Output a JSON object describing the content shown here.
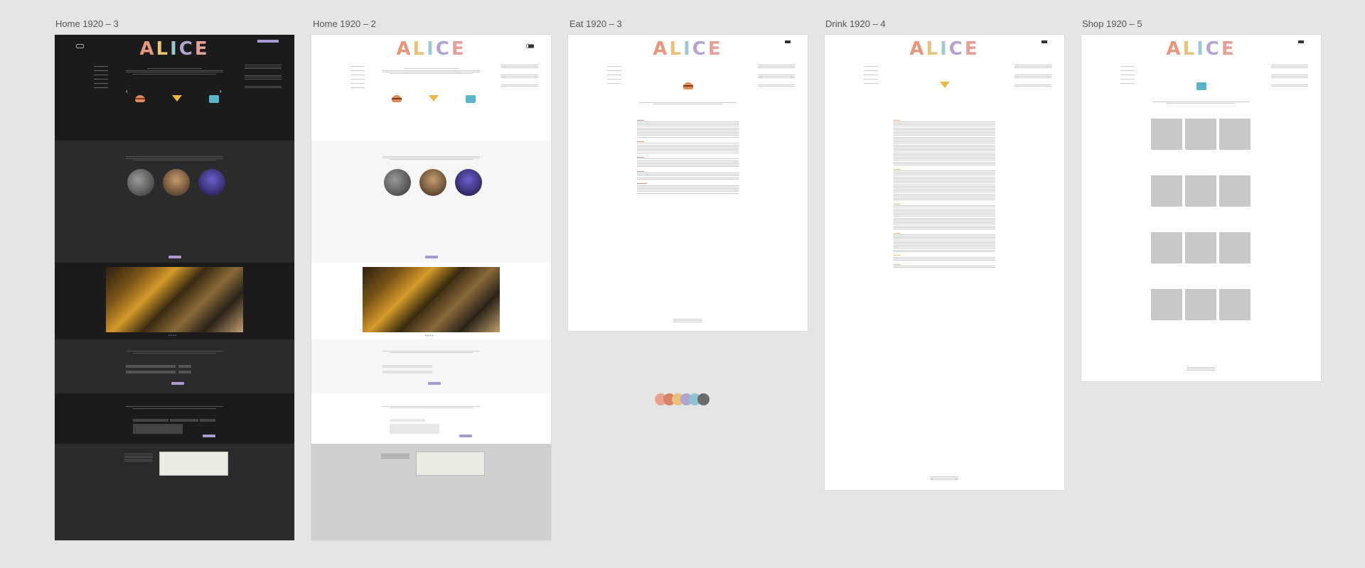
{
  "boards": [
    {
      "title": "Home 1920 – 3"
    },
    {
      "title": "Home 1920 – 2"
    },
    {
      "title": "Eat 1920 – 3"
    },
    {
      "title": "Drink 1920 – 4"
    },
    {
      "title": "Shop 1920 – 5"
    }
  ],
  "logo": [
    "A",
    "L",
    "I",
    "C",
    "E"
  ],
  "colors": {
    "palette": [
      "#e6a18f",
      "#d9826a",
      "#e8c27a",
      "#b3a4cf",
      "#8ec4d0",
      "#6a6a6a"
    ]
  }
}
